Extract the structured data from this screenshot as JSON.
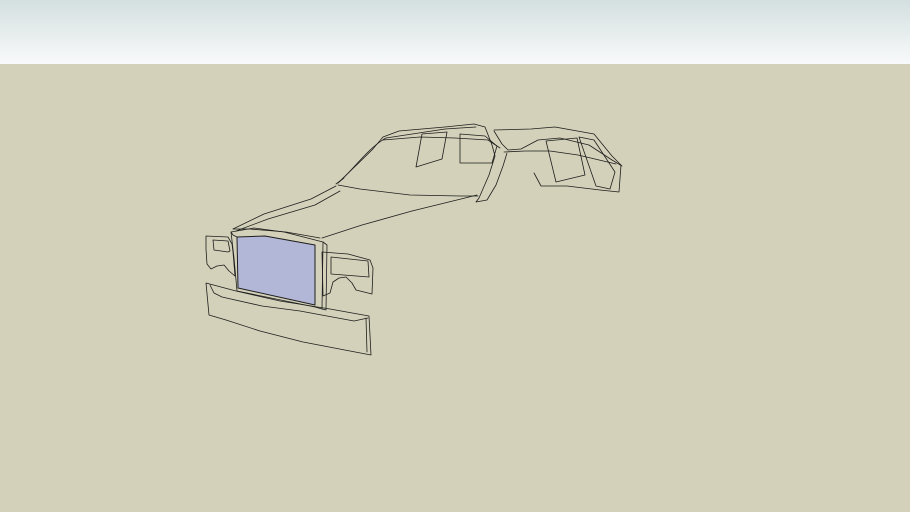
{
  "scene": {
    "sky_color_top": "#d4dfe0",
    "sky_color_bottom": "#f8fafa",
    "ground_color": "#d3d1b9",
    "line_color": "#1e1e1e",
    "selected_face_color": "#b3b7d7",
    "model_parts": [
      "windshield-frame",
      "rear-window-frame",
      "roof-line",
      "hood",
      "grille",
      "left-headlight-fender",
      "right-headlight-fender",
      "front-bumper"
    ]
  }
}
